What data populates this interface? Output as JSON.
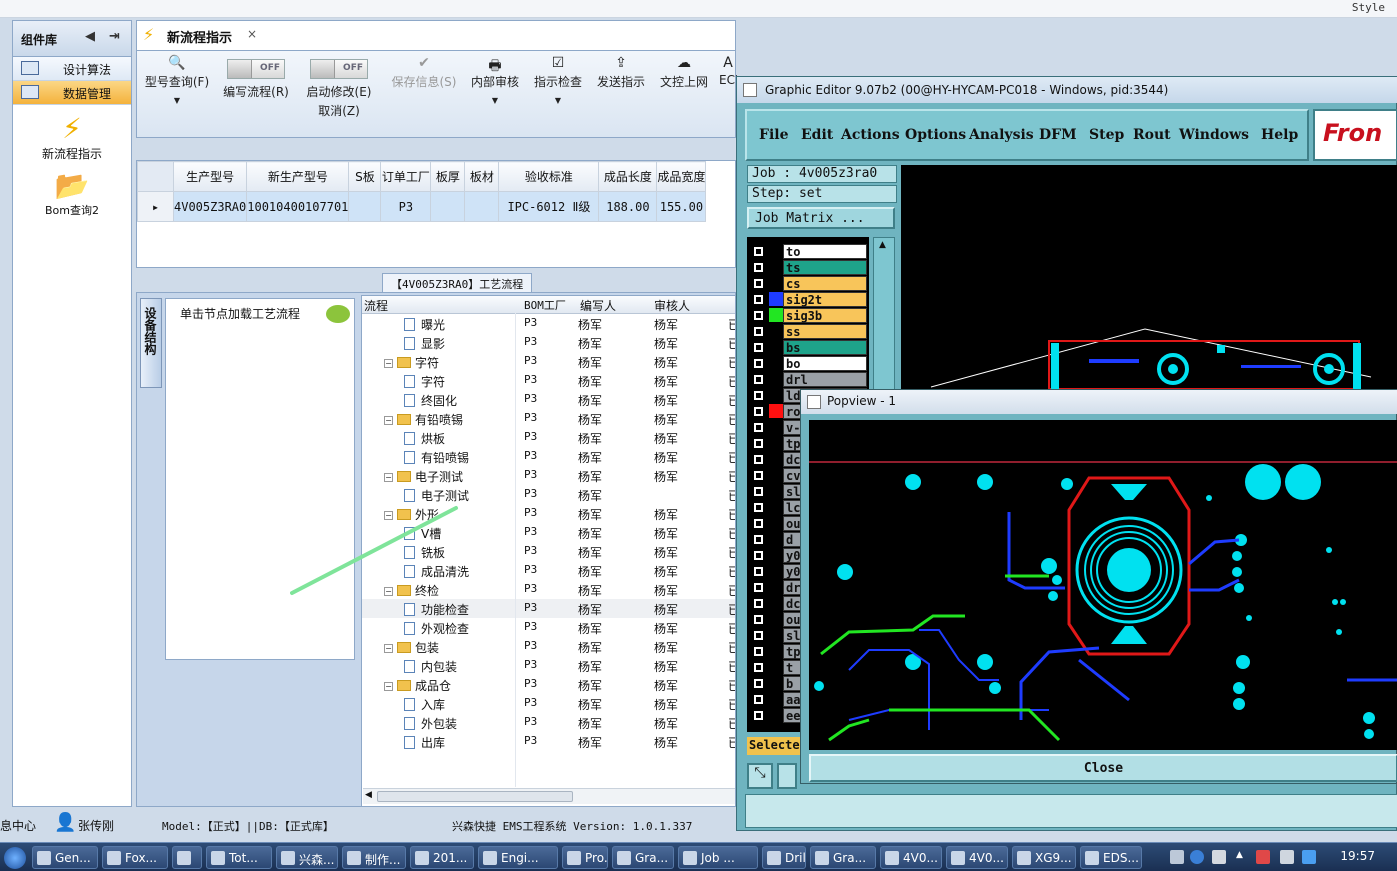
{
  "top_bar": {
    "style_label": "Style"
  },
  "library": {
    "title": "组件库",
    "items": [
      "设计算法",
      "数据管理"
    ],
    "tools": [
      {
        "label": "新流程指示",
        "icon": "lightning-icon"
      },
      {
        "label": "Bom查询2",
        "icon": "folder-open-icon"
      }
    ]
  },
  "tab": {
    "title": "新流程指示",
    "close": "×"
  },
  "toolbar": {
    "model_query": "型号查询(F)",
    "write_flow": "编写流程(R)",
    "auto_modify": "启动修改(E)",
    "cancel": "取消(Z)",
    "toggle_off": "OFF",
    "save_info": "保存信息(S)",
    "internal_review": "内部审核",
    "instruction_check": "指示检查",
    "send_upload": "发送指示",
    "doc_upload": "文控上网",
    "ecn": "ECN"
  },
  "grid": {
    "headers": [
      "生产型号",
      "新生产型号",
      "S板",
      "订单工厂",
      "板厚",
      "板材",
      "验收标准",
      "成品长度",
      "成品宽度"
    ],
    "row": [
      "4V005Z3RA0",
      "10010400107701",
      "",
      "P3",
      "",
      "",
      "IPC-6012 Ⅱ级",
      "188.00",
      "155.00"
    ]
  },
  "process": {
    "caption": "【4V005Z3RA0】工艺流程",
    "side_tab": "设备结构",
    "hint": "单击节点加载工艺流程",
    "headers": [
      "流程",
      "BOM工厂",
      "编写人",
      "审核人"
    ],
    "rows": [
      {
        "name": "曝光",
        "level": 2,
        "factory": "P3",
        "writer": "杨军",
        "reviewer": "杨军"
      },
      {
        "name": "显影",
        "level": 2,
        "factory": "P3",
        "writer": "杨军",
        "reviewer": "杨军"
      },
      {
        "name": "字符",
        "level": 1,
        "factory": "P3",
        "writer": "杨军",
        "reviewer": "杨军"
      },
      {
        "name": "字符",
        "level": 2,
        "factory": "P3",
        "writer": "杨军",
        "reviewer": "杨军"
      },
      {
        "name": "终固化",
        "level": 2,
        "factory": "P3",
        "writer": "杨军",
        "reviewer": "杨军"
      },
      {
        "name": "有铅喷锡",
        "level": 1,
        "factory": "P3",
        "writer": "杨军",
        "reviewer": "杨军"
      },
      {
        "name": "烘板",
        "level": 2,
        "factory": "P3",
        "writer": "杨军",
        "reviewer": "杨军"
      },
      {
        "name": "有铅喷锡",
        "level": 2,
        "factory": "P3",
        "writer": "杨军",
        "reviewer": "杨军"
      },
      {
        "name": "电子测试",
        "level": 1,
        "factory": "P3",
        "writer": "杨军",
        "reviewer": "杨军"
      },
      {
        "name": "电子测试",
        "level": 2,
        "factory": "P3",
        "writer": "杨军",
        "reviewer": ""
      },
      {
        "name": "外形",
        "level": 1,
        "factory": "P3",
        "writer": "杨军",
        "reviewer": "杨军"
      },
      {
        "name": "V槽",
        "level": 2,
        "factory": "P3",
        "writer": "杨军",
        "reviewer": "杨军"
      },
      {
        "name": "铣板",
        "level": 2,
        "factory": "P3",
        "writer": "杨军",
        "reviewer": "杨军"
      },
      {
        "name": "成品清洗",
        "level": 2,
        "factory": "P3",
        "writer": "杨军",
        "reviewer": "杨军"
      },
      {
        "name": "终检",
        "level": 1,
        "factory": "P3",
        "writer": "杨军",
        "reviewer": "杨军"
      },
      {
        "name": "功能检查",
        "level": 2,
        "factory": "P3",
        "writer": "杨军",
        "reviewer": "杨军"
      },
      {
        "name": "外观检查",
        "level": 2,
        "factory": "P3",
        "writer": "杨军",
        "reviewer": "杨军"
      },
      {
        "name": "包装",
        "level": 1,
        "factory": "P3",
        "writer": "杨军",
        "reviewer": "杨军"
      },
      {
        "name": "内包装",
        "level": 2,
        "factory": "P3",
        "writer": "杨军",
        "reviewer": "杨军"
      },
      {
        "name": "成品仓",
        "level": 1,
        "factory": "P3",
        "writer": "杨军",
        "reviewer": "杨军"
      },
      {
        "name": "入库",
        "level": 2,
        "factory": "P3",
        "writer": "杨军",
        "reviewer": "杨军"
      },
      {
        "name": "外包装",
        "level": 2,
        "factory": "P3",
        "writer": "杨军",
        "reviewer": "杨军"
      },
      {
        "name": "出库",
        "level": 2,
        "factory": "P3",
        "writer": "杨军",
        "reviewer": "杨军"
      }
    ],
    "right_col_char": "已"
  },
  "status": {
    "left": "息中心",
    "user": "张传刚",
    "model": "Model:【正式】||DB:【正式库】",
    "version": "兴森快捷 EMS工程系统 Version: 1.0.1.337"
  },
  "graphic_editor": {
    "title": "Graphic Editor 9.07b2 (00@HY-HYCAM-PC018 - Windows, pid:3544)",
    "menus": [
      "File",
      "Edit",
      "Actions",
      "Options",
      "Analysis",
      "DFM",
      "Step",
      "Rout",
      "Windows",
      "Help"
    ],
    "logo": "Fron",
    "job": "Job : 4v005z3ra0",
    "step": "Step: set",
    "matrix_button": "Job Matrix ...",
    "selected": "Selected",
    "layers": [
      {
        "name": "to",
        "bg": "#ffffff",
        "swatch": "#000000"
      },
      {
        "name": "ts",
        "bg": "#1ea38a",
        "swatch": "#000000"
      },
      {
        "name": "cs",
        "bg": "#f8c55a",
        "swatch": "#000000"
      },
      {
        "name": "sig2t",
        "bg": "#f8c55a",
        "swatch": "#1e3cff"
      },
      {
        "name": "sig3b",
        "bg": "#f8c55a",
        "swatch": "#22e622"
      },
      {
        "name": "ss",
        "bg": "#f8c55a",
        "swatch": "#000000"
      },
      {
        "name": "bs",
        "bg": "#1ea38a",
        "swatch": "#000000"
      },
      {
        "name": "bo",
        "bg": "#ffffff",
        "swatch": "#000000"
      },
      {
        "name": "drl",
        "bg": "#9aa0a6",
        "swatch": "#000000"
      },
      {
        "name": "ld",
        "bg": "#9aa0a6",
        "swatch": "#000000"
      },
      {
        "name": "ro",
        "bg": "#9aa0a6",
        "swatch": "#ff1010"
      },
      {
        "name": "v-",
        "bg": "#9aa0a6",
        "swatch": "#000000"
      },
      {
        "name": "tp",
        "bg": "#9aa0a6",
        "swatch": "#000000"
      },
      {
        "name": "dc",
        "bg": "#9aa0a6",
        "swatch": "#000000"
      },
      {
        "name": "cv",
        "bg": "#9aa0a6",
        "swatch": "#000000"
      },
      {
        "name": "sl",
        "bg": "#9aa0a6",
        "swatch": "#000000"
      },
      {
        "name": "lc",
        "bg": "#9aa0a6",
        "swatch": "#000000"
      },
      {
        "name": "ou",
        "bg": "#9aa0a6",
        "swatch": "#000000"
      },
      {
        "name": "d",
        "bg": "#9aa0a6",
        "swatch": "#000000"
      },
      {
        "name": "y0",
        "bg": "#9aa0a6",
        "swatch": "#000000"
      },
      {
        "name": "y0",
        "bg": "#9aa0a6",
        "swatch": "#000000"
      },
      {
        "name": "dr",
        "bg": "#9aa0a6",
        "swatch": "#000000"
      },
      {
        "name": "dc",
        "bg": "#9aa0a6",
        "swatch": "#000000"
      },
      {
        "name": "ou",
        "bg": "#9aa0a6",
        "swatch": "#000000"
      },
      {
        "name": "sl",
        "bg": "#9aa0a6",
        "swatch": "#000000"
      },
      {
        "name": "tp",
        "bg": "#9aa0a6",
        "swatch": "#000000"
      },
      {
        "name": "t",
        "bg": "#9aa0a6",
        "swatch": "#000000"
      },
      {
        "name": "b",
        "bg": "#9aa0a6",
        "swatch": "#000000"
      },
      {
        "name": "aa",
        "bg": "#9aa0a6",
        "swatch": "#000000"
      },
      {
        "name": "ee",
        "bg": "#9aa0a6",
        "swatch": "#000000"
      }
    ]
  },
  "popview": {
    "title": "Popview - 1",
    "close": "Close"
  },
  "taskbar": {
    "tasks": [
      "Gen...",
      "Fox...",
      "",
      "Tot...",
      "兴森...",
      "制作...",
      "201...",
      "Engi...",
      "Pro...",
      "Gra...",
      "Job ...",
      "Drill...",
      "Gra...",
      "4V0...",
      "4V0...",
      "XG9...",
      "EDS..."
    ],
    "time": "19:57"
  },
  "colors": {
    "accent": "#f4b23c",
    "ge_bg": "#6fb4c0",
    "pad": "#00e1f0",
    "trace_blue": "#1e3cff",
    "trace_green": "#22e622",
    "outline_red": "#e01818"
  }
}
